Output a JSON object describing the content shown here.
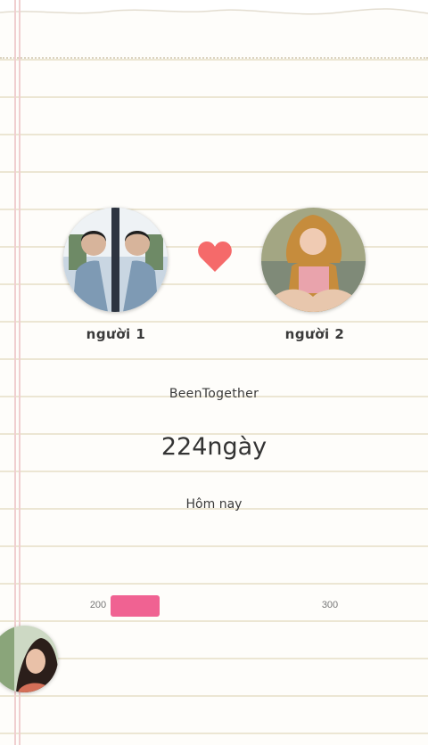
{
  "person1": {
    "name": "người 1"
  },
  "person2": {
    "name": "người 2"
  },
  "heart_color": "#f56a6a",
  "title": "BeenTogether",
  "counter": "224ngày",
  "today_label": "Hôm nay",
  "progress": {
    "min_label": "200",
    "max_label": "300",
    "fraction": 0.24,
    "color": "#f06292"
  }
}
